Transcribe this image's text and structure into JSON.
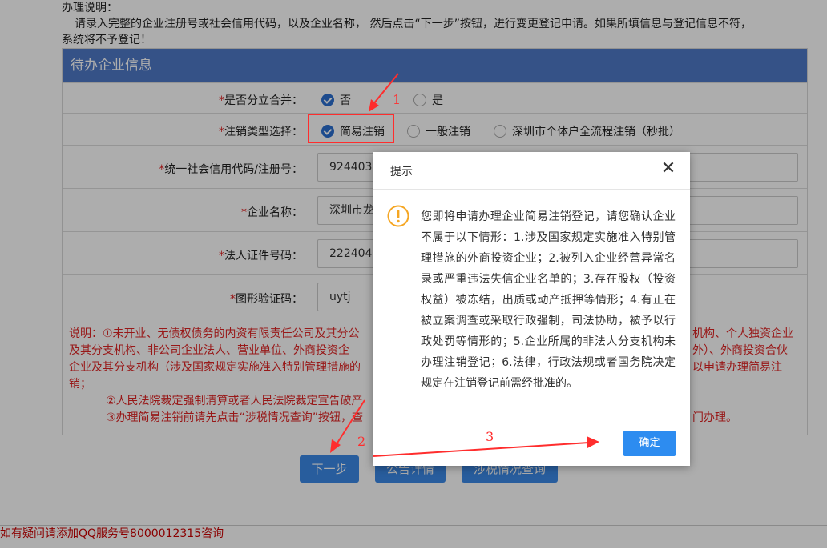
{
  "intro": {
    "heading": "办理说明：",
    "line1": "请录入完整的企业注册号或社会信用代码，以及企业名称， 然后点击“下一步”按钮，进行变更登记申请。如果所填信息与登记信息不符，",
    "line2": "系统将不予登记！"
  },
  "panel": {
    "title": "待办企业信息",
    "fields": {
      "merge_label": "是否分立合并：",
      "merge_no": "否",
      "merge_yes": "是",
      "cancel_type_label": "注销类型选择：",
      "cancel_simple": "简易注销",
      "cancel_general": "一般注销",
      "cancel_shenzhen": "深圳市个体户全流程注销（秒批）",
      "credit_code_label": "统一社会信用代码/注册号：",
      "credit_code_value": "924403",
      "company_name_label": "企业名称：",
      "company_name_value": "深圳市龙",
      "legal_id_label": "法人证件号码：",
      "legal_id_value": "222404",
      "captcha_label": "图形验证码：",
      "captcha_value": "uytj"
    },
    "required_mark": "*",
    "notes": {
      "n1a": "说明：①未开业、无债权债务的内资有限责任公司及其分公",
      "n1a_right": "机构、个人独资企业",
      "n1b": "及其分支机构、非公司企业法人、营业单位、外商投资企",
      "n1b_right": "外）、外商投资合伙",
      "n1c": "企业及其分支机构（涉及国家规定实施准入特别管理措施的",
      "n1c_right": "以申请办理简易注",
      "n1d": "销；",
      "n2": "②人民法院裁定强制清算或者人民法院裁定宣告破产",
      "n3": "③办理简易注销前请先点击“涉税情况查询”按钮，查",
      "n3_right": "门办理。"
    }
  },
  "buttons": {
    "next": "下一步",
    "notice": "公告详情",
    "tax": "涉税情况查询"
  },
  "footer": {
    "text": "如有疑问请添加QQ服务号8000012315咨询"
  },
  "dialog": {
    "title": "提示",
    "close_glyph": "✕",
    "message": "您即将申请办理企业简易注销登记，请您确认企业不属于以下情形：1.涉及国家规定实施准入特别管理措施的外商投资企业；2.被列入企业经营异常名录或严重违法失信企业名单的；3.存在股权（投资权益）被冻结，出质或动产抵押等情形；4.有正在被立案调查或采取行政强制，司法协助，被予以行政处罚等情形的；5.企业所属的非法人分支机构未办理注销登记；6.法律，行政法规或者国务院决定规定在注销登记前需经批准的。",
    "ok": "确定",
    "icon": "warning-icon"
  },
  "annotations": {
    "a1": "1",
    "a2": "2",
    "a3": "3"
  },
  "colors": {
    "header": "#4e79c8",
    "primary": "#3c8ae8",
    "required": "#e02020",
    "annotation": "#ff2d2d"
  }
}
